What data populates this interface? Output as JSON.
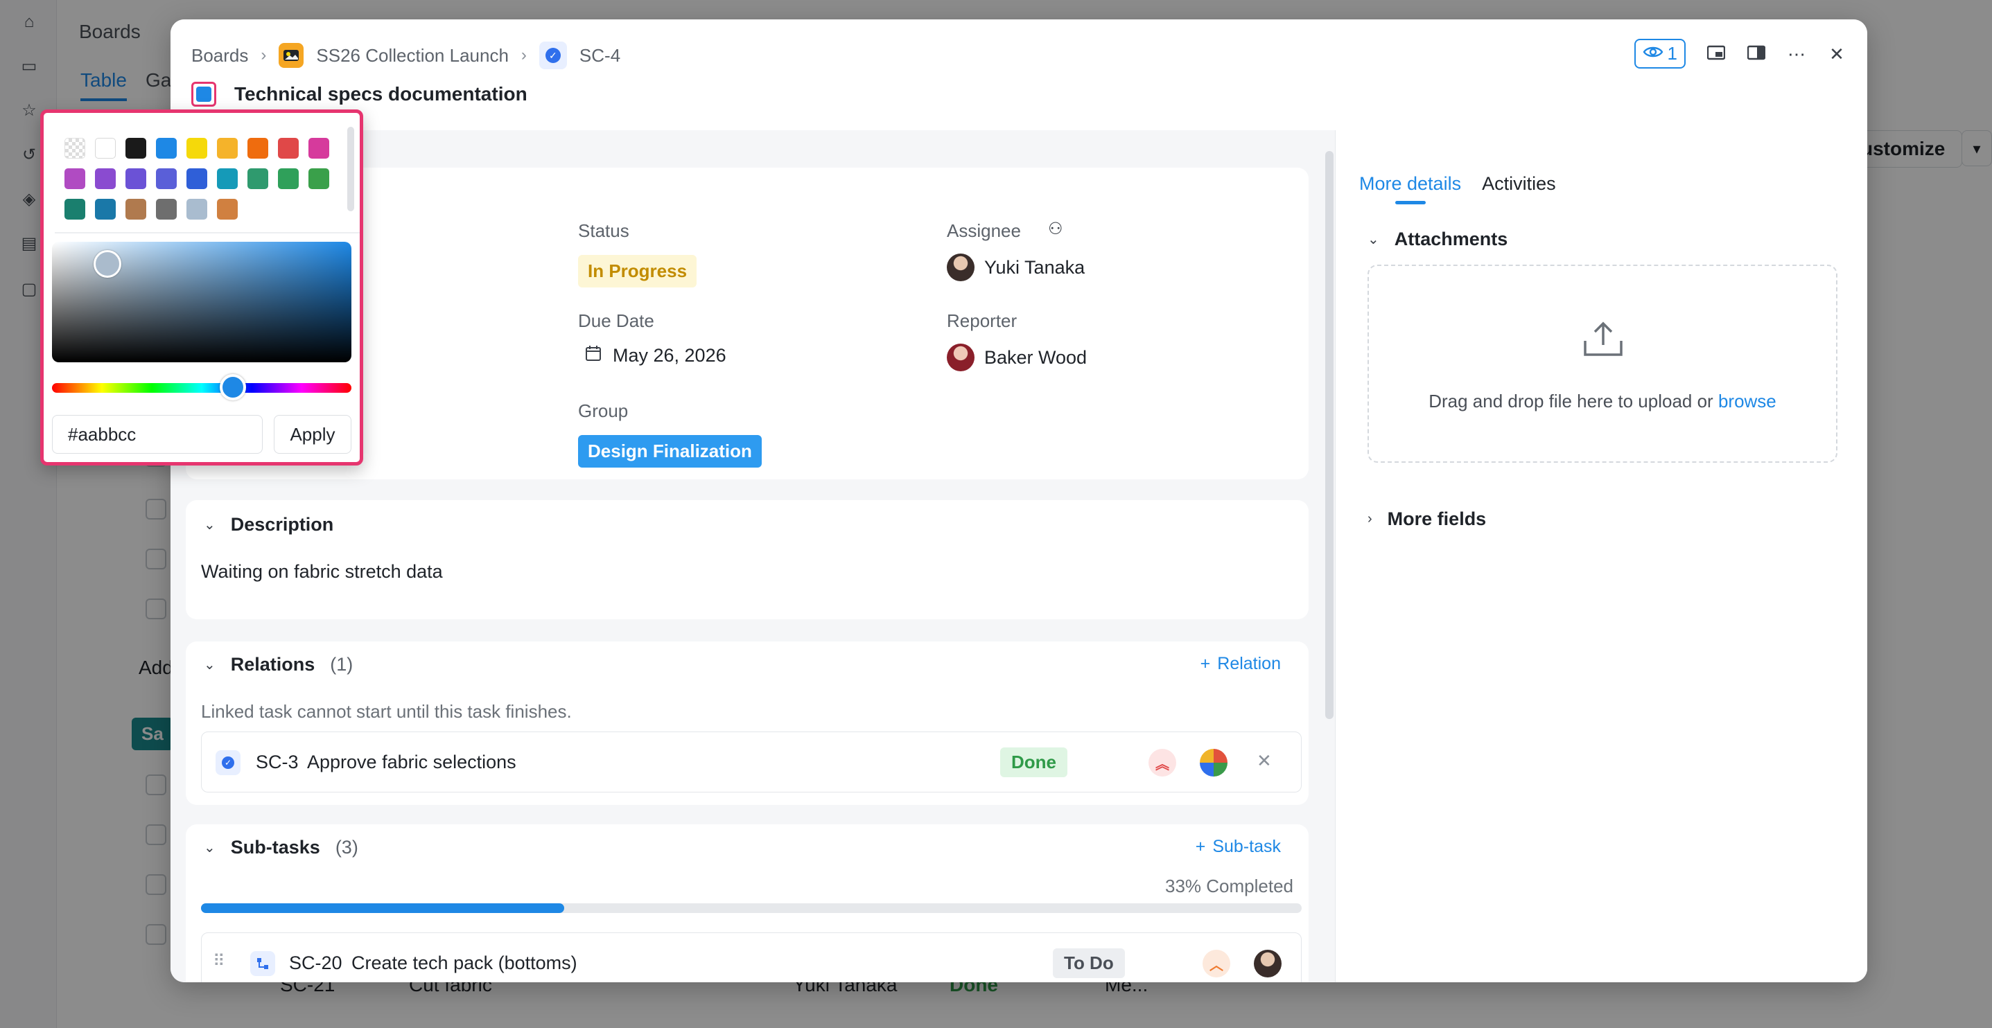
{
  "background": {
    "breadcrumb": "Boards",
    "tabs": [
      "Table",
      "Ga"
    ],
    "customize_label": "ustomize",
    "add_label": "Add",
    "group_label": "Sa",
    "row": {
      "id": "SC-21",
      "name": "Cut fabric",
      "assignee": "Yuki Tanaka",
      "status": "Done",
      "priority": "Me..."
    }
  },
  "modal": {
    "breadcrumb": {
      "root": "Boards",
      "project": "SS26 Collection Launch",
      "task": "SC-4"
    },
    "title": "Technical specs documentation",
    "watch_count": "1",
    "icons": [
      "eye-icon",
      "picture-in-picture-icon",
      "side-panel-icon",
      "more-icon",
      "close-icon"
    ],
    "details": {
      "status_label": "Status",
      "status_value": "In Progress",
      "assignee_label": "Assignee",
      "assignee_value": "Yuki Tanaka",
      "due_label": "Due Date",
      "due_value": "May 26, 2026",
      "reporter_label": "Reporter",
      "reporter_value": "Baker Wood",
      "group_label": "Group",
      "group_value": "Design Finalization"
    },
    "description": {
      "heading": "Description",
      "text": "Waiting on fabric stretch data"
    },
    "relations": {
      "heading": "Relations",
      "count": "(1)",
      "action": "Relation",
      "hint": "Linked task cannot start until this task finishes.",
      "items": [
        {
          "id": "SC-3",
          "name": "Approve fabric selections",
          "status": "Done"
        }
      ]
    },
    "subtasks": {
      "heading": "Sub-tasks",
      "count": "(3)",
      "action": "Sub-task",
      "completed_label": "33% Completed",
      "progress": 0.33,
      "items": [
        {
          "id": "SC-20",
          "name": "Create tech pack (bottoms)",
          "status": "To Do"
        }
      ]
    },
    "right_panel": {
      "tabs": [
        "More details",
        "Activities"
      ],
      "attachments_heading": "Attachments",
      "drop_text": "Drag and drop file here to upload or",
      "browse_link": "browse",
      "more_fields": "More fields"
    }
  },
  "color_picker": {
    "swatches": [
      "transparent",
      "#ffffff",
      "#1a1a1a",
      "#1e88e5",
      "#f5d90a",
      "#f5b32a",
      "#ef6c0e",
      "#e04848",
      "#d63a9c",
      "#b04bc2",
      "#8a4bd0",
      "#6b52d6",
      "#5a5fd8",
      "#2f5fd8",
      "#159ab8",
      "#2f9a6e",
      "#2fa05a",
      "#3aa04a",
      "#1a7f6e",
      "#1a78a8",
      "#b07a4e",
      "#6e6e6e",
      "#a9bccf",
      "#d08040"
    ],
    "hex_value": "#aabbcc",
    "apply_label": "Apply",
    "accent": "#e6356f"
  }
}
